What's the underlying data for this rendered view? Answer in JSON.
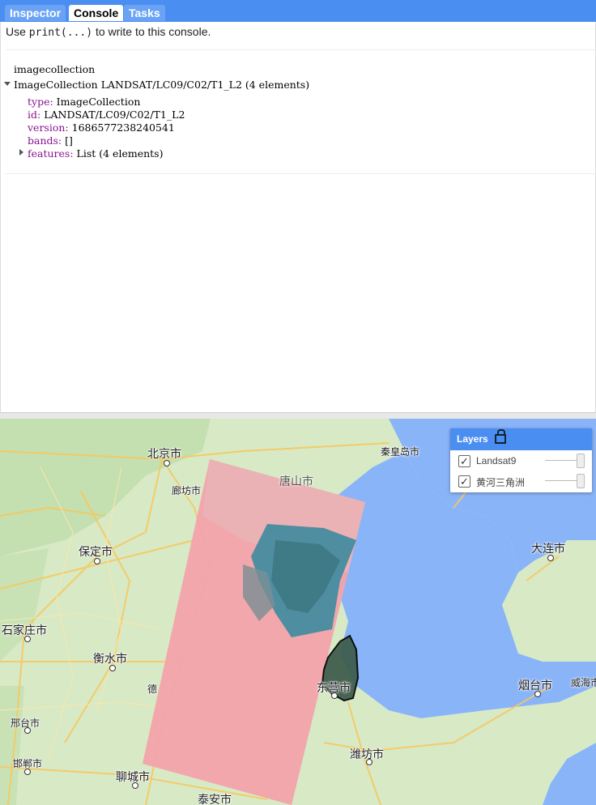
{
  "tabs": [
    {
      "label": "Inspector"
    },
    {
      "label": "Console"
    },
    {
      "label": "Tasks"
    }
  ],
  "console": {
    "hint_prefix": "Use ",
    "hint_code": "print(...)",
    "hint_suffix": " to write to this console.",
    "var_name": "imagecollection",
    "summary": "ImageCollection LANDSAT/LC09/C02/T1_L2 (4 elements)",
    "fields": [
      {
        "key": "type:",
        "value": " ImageCollection"
      },
      {
        "key": "id:",
        "value": " LANDSAT/LC09/C02/T1_L2"
      },
      {
        "key": "version:",
        "value": " 1686577238240541"
      },
      {
        "key": "bands:",
        "value": " []"
      },
      {
        "key": "features:",
        "value": " List (4 elements)"
      }
    ]
  },
  "layers_panel": {
    "title": "Layers",
    "items": [
      {
        "name": "Landsat9",
        "checked": true
      },
      {
        "name": "黄河三角洲",
        "checked": true
      }
    ]
  },
  "map_labels": {
    "beijing": "北京市",
    "langfang": "廊坊市",
    "tangshan": "唐山市",
    "qinhuangdao": "秦皇岛市",
    "baoding": "保定市",
    "dalian": "大连市",
    "shijiazhuang": "石家庄市",
    "hengshui": "衡水市",
    "dezhou": "德",
    "dongying": "东营市",
    "yantai": "烟台市",
    "weihai": "威海市",
    "xingtai": "邢台市",
    "handan": "邯郸市",
    "liaocheng": "聊城市",
    "weifang": "潍坊市",
    "taian": "泰安市"
  },
  "colors": {
    "accent": "#4a8ef1",
    "sea": "#8ab4f8",
    "land": "#d7e8c5",
    "landsat": "#f2a3aa",
    "roads": "#f6c85f"
  }
}
